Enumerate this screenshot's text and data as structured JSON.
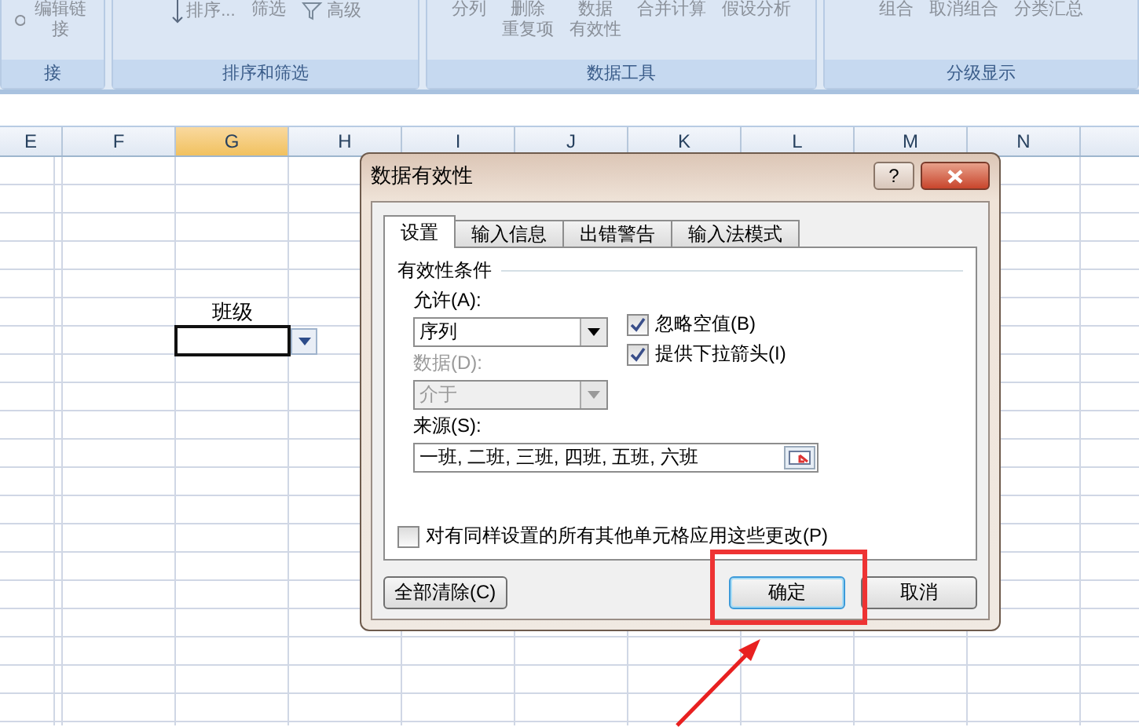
{
  "ribbon": {
    "groups": [
      {
        "label": "接",
        "items": [
          {
            "kind": "link",
            "text": "编辑链接"
          }
        ]
      },
      {
        "label": "排序和筛选",
        "items": [
          {
            "kind": "sort",
            "text": "排序..."
          },
          {
            "kind": "plain",
            "text": "筛选"
          },
          {
            "kind": "filter",
            "text": "高级"
          }
        ]
      },
      {
        "label": "数据工具",
        "items": [
          {
            "kind": "plain",
            "text": "分列"
          },
          {
            "kind": "plain",
            "lines": [
              "删除",
              "重复项"
            ]
          },
          {
            "kind": "plain",
            "lines": [
              "数据",
              "有效性"
            ]
          },
          {
            "kind": "plain",
            "text": "合并计算"
          },
          {
            "kind": "plain",
            "text": "假设分析"
          }
        ]
      },
      {
        "label": "分级显示",
        "items": [
          {
            "kind": "plain",
            "text": "组合"
          },
          {
            "kind": "plain",
            "text": "取消组合"
          },
          {
            "kind": "plain",
            "text": "分类汇总"
          }
        ]
      }
    ]
  },
  "sheet": {
    "columns": [
      {
        "label": "E",
        "selected": false
      },
      {
        "label": "F",
        "selected": false
      },
      {
        "label": "G",
        "selected": true
      },
      {
        "label": "H",
        "selected": false
      },
      {
        "label": "I",
        "selected": false
      },
      {
        "label": "J",
        "selected": false
      },
      {
        "label": "K",
        "selected": false
      },
      {
        "label": "L",
        "selected": false
      },
      {
        "label": "M",
        "selected": false
      },
      {
        "label": "N",
        "selected": false
      }
    ],
    "cell_text": "班级"
  },
  "dialog": {
    "title": "数据有效性",
    "help": "?",
    "tabs": [
      {
        "label": "设置",
        "selected": true
      },
      {
        "label": "输入信息",
        "selected": false
      },
      {
        "label": "出错警告",
        "selected": false
      },
      {
        "label": "输入法模式",
        "selected": false
      }
    ],
    "section": "有效性条件",
    "allow": {
      "label": "允许(A):",
      "value": "序列",
      "disabled": false
    },
    "data": {
      "label": "数据(D):",
      "value": "介于",
      "disabled": true
    },
    "checks": [
      {
        "label": "忽略空值(B)",
        "checked": true
      },
      {
        "label": "提供下拉箭头(I)",
        "checked": true
      }
    ],
    "source": {
      "label": "来源(S):",
      "value": "一班, 二班, 三班, 四班, 五班, 六班"
    },
    "apply_all": {
      "label": "对有同样设置的所有其他单元格应用这些更改(P)",
      "checked": false
    },
    "buttons": {
      "clear": "全部清除(C)",
      "ok": "确定",
      "cancel": "取消"
    }
  }
}
